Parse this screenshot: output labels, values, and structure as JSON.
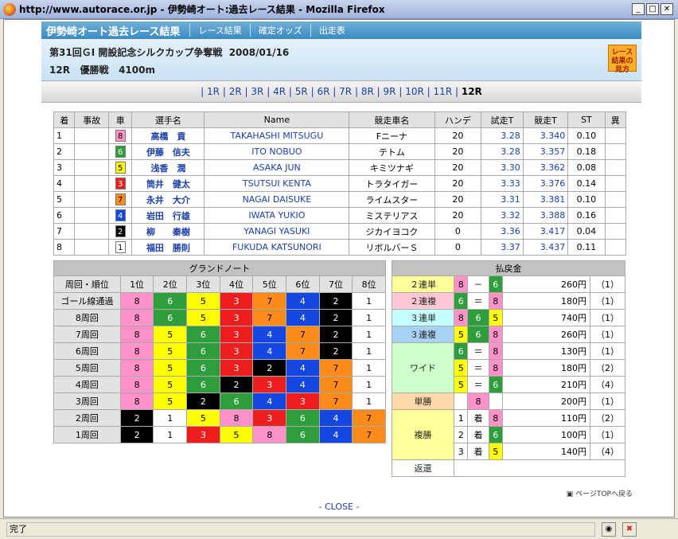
{
  "window": {
    "title": "http://www.autorace.or.jp - 伊勢崎オート:過去レース結果 - Mozilla Firefox",
    "minimize": "_",
    "maximize": "□",
    "close": "✕"
  },
  "header": {
    "site_title": "伊勢崎オート過去レース結果",
    "nav": [
      "レース結果",
      "確定オッズ",
      "出走表"
    ]
  },
  "race": {
    "event": "第31回ＧⅠ 開設記念シルクカップ争奪戦",
    "date": "2008/01/16",
    "race_no": "12R",
    "race_type": "優勝戦",
    "distance": "4100m",
    "howto": "レース結果の見方"
  },
  "race_nav": {
    "links": [
      "1R",
      "2R",
      "3R",
      "4R",
      "5R",
      "6R",
      "7R",
      "8R",
      "9R",
      "10R",
      "11R"
    ],
    "current": "12R",
    "sep": "|"
  },
  "results": {
    "headers": [
      "着",
      "事故",
      "車",
      "選手名",
      "Name",
      "競走車名",
      "ハンデ",
      "試走T",
      "競走T",
      "ST",
      "異"
    ],
    "rows": [
      {
        "pos": "1",
        "acc": "",
        "car": "8",
        "jp": "高橋　貢",
        "en": "TAKAHASHI MITSUGU",
        "bike": "Fニーナ",
        "hc": "20",
        "trial": "3.28",
        "race": "3.340",
        "st": "0.10",
        "ex": ""
      },
      {
        "pos": "2",
        "acc": "",
        "car": "6",
        "jp": "伊藤　信夫",
        "en": "ITO NOBUO",
        "bike": "テトム",
        "hc": "20",
        "trial": "3.28",
        "race": "3.357",
        "st": "0.18",
        "ex": ""
      },
      {
        "pos": "3",
        "acc": "",
        "car": "5",
        "jp": "浅香　潤",
        "en": "ASAKA JUN",
        "bike": "キミツナギ",
        "hc": "20",
        "trial": "3.30",
        "race": "3.362",
        "st": "0.08",
        "ex": ""
      },
      {
        "pos": "4",
        "acc": "",
        "car": "3",
        "jp": "筒井　健太",
        "en": "TSUTSUI KENTA",
        "bike": "トラタイガー",
        "hc": "20",
        "trial": "3.33",
        "race": "3.376",
        "st": "0.14",
        "ex": ""
      },
      {
        "pos": "5",
        "acc": "",
        "car": "7",
        "jp": "永井　大介",
        "en": "NAGAI DAISUKE",
        "bike": "ライムスター",
        "hc": "20",
        "trial": "3.31",
        "race": "3.381",
        "st": "0.10",
        "ex": ""
      },
      {
        "pos": "6",
        "acc": "",
        "car": "4",
        "jp": "岩田　行雄",
        "en": "IWATA YUKIO",
        "bike": "ミステリアス",
        "hc": "20",
        "trial": "3.32",
        "race": "3.388",
        "st": "0.16",
        "ex": ""
      },
      {
        "pos": "7",
        "acc": "",
        "car": "2",
        "jp": "柳　　秦樹",
        "en": "YANAGI YASUKI",
        "bike": "ジカイヨコク",
        "hc": "0",
        "trial": "3.36",
        "race": "3.417",
        "st": "0.04",
        "ex": ""
      },
      {
        "pos": "8",
        "acc": "",
        "car": "1",
        "jp": "福田　勝則",
        "en": "FUKUDA KATSUNORI",
        "bike": "リボルバーＳ",
        "hc": "0",
        "trial": "3.37",
        "race": "3.437",
        "st": "0.11",
        "ex": ""
      }
    ]
  },
  "grand_note": {
    "title": "グランドノート",
    "corner": "周回・順位",
    "headers": [
      "1位",
      "2位",
      "3位",
      "4位",
      "5位",
      "6位",
      "7位",
      "8位"
    ],
    "rows": [
      {
        "lap": "ゴール線通過",
        "order": [
          "8",
          "6",
          "5",
          "3",
          "7",
          "4",
          "2",
          "1"
        ]
      },
      {
        "lap": "8周回",
        "order": [
          "8",
          "6",
          "5",
          "3",
          "7",
          "4",
          "2",
          "1"
        ]
      },
      {
        "lap": "7周回",
        "order": [
          "8",
          "5",
          "6",
          "3",
          "4",
          "7",
          "2",
          "1"
        ]
      },
      {
        "lap": "6周回",
        "order": [
          "8",
          "5",
          "6",
          "3",
          "4",
          "7",
          "2",
          "1"
        ]
      },
      {
        "lap": "5周回",
        "order": [
          "8",
          "5",
          "6",
          "3",
          "2",
          "4",
          "7",
          "1"
        ]
      },
      {
        "lap": "4周回",
        "order": [
          "8",
          "5",
          "6",
          "2",
          "3",
          "4",
          "7",
          "1"
        ]
      },
      {
        "lap": "3周回",
        "order": [
          "8",
          "5",
          "2",
          "6",
          "4",
          "3",
          "7",
          "1"
        ]
      },
      {
        "lap": "2周回",
        "order": [
          "2",
          "1",
          "5",
          "8",
          "3",
          "6",
          "4",
          "7"
        ]
      },
      {
        "lap": "1周回",
        "order": [
          "2",
          "1",
          "3",
          "5",
          "8",
          "6",
          "4",
          "7"
        ]
      }
    ]
  },
  "payout": {
    "title": "払戻金",
    "rows": [
      {
        "type": "２連単",
        "cls": "y",
        "cars": [
          "8",
          "－",
          "6"
        ],
        "amount": "260円",
        "pop": "（1）"
      },
      {
        "type": "２連複",
        "cls": "p",
        "cars": [
          "6",
          "＝",
          "8"
        ],
        "amount": "180円",
        "pop": "（1）"
      },
      {
        "type": "３連単",
        "cls": "cy",
        "cars": [
          "8",
          "6",
          "5"
        ],
        "amount": "740円",
        "pop": "（1）"
      },
      {
        "type": "３連複",
        "cls": "bl",
        "cars": [
          "5",
          "6",
          "8"
        ],
        "amount": "260円",
        "pop": "（1）"
      }
    ],
    "wide": {
      "type": "ワイド",
      "rows": [
        {
          "cars": [
            "6",
            "＝",
            "8"
          ],
          "amount": "130円",
          "pop": "（1）"
        },
        {
          "cars": [
            "5",
            "＝",
            "8"
          ],
          "amount": "180円",
          "pop": "（2）"
        },
        {
          "cars": [
            "5",
            "＝",
            "6"
          ],
          "amount": "210円",
          "pop": "（4）"
        }
      ]
    },
    "tan": {
      "type": "単勝",
      "car": "8",
      "amount": "200円",
      "pop": "（1）"
    },
    "fuku": {
      "type": "複勝",
      "rows": [
        {
          "n": "1",
          "chaku": "着",
          "car": "8",
          "amount": "110円",
          "pop": "（2）"
        },
        {
          "n": "2",
          "chaku": "着",
          "car": "6",
          "amount": "100円",
          "pop": "（1）"
        },
        {
          "n": "3",
          "chaku": "着",
          "car": "5",
          "amount": "140円",
          "pop": "（4）"
        }
      ]
    },
    "refund": {
      "type": "返還",
      "value": ""
    }
  },
  "footer": {
    "pagetop": "ページTOPへ戻る",
    "close": "- CLOSE -"
  },
  "status": {
    "text": "完了"
  }
}
